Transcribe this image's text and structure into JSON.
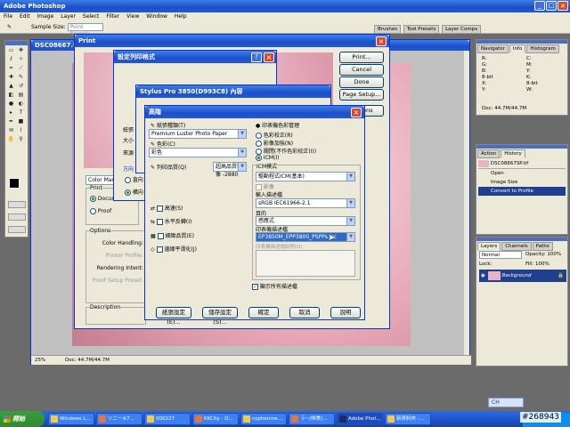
{
  "app": {
    "title": "Adobe Photoshop",
    "menus": [
      "File",
      "Edit",
      "Image",
      "Layer",
      "Select",
      "Filter",
      "View",
      "Window",
      "Help"
    ],
    "options": {
      "sample_size_label": "Sample Size:",
      "sample_size_value": "Point Sample"
    }
  },
  "panel_tabs_top": [
    "Brushes",
    "Tool Presets",
    "Layer Comps"
  ],
  "document": {
    "title": "DSC08667.ti",
    "zoom": "25%",
    "doc_size": "Doc: 44.7M/44.7M"
  },
  "print_dialog": {
    "title": "Print",
    "buttons": [
      "Print...",
      "Cancel",
      "Done",
      "Page Setup...",
      "Options"
    ],
    "color_management_label": "Color Man",
    "print_group": "Print",
    "print_opts": [
      "Docume",
      "Proof"
    ],
    "options_label": "Options",
    "color_handling_label": "Color Handling:",
    "printer_profile_label": "Printer Profile:",
    "rendering_intent_label": "Rendering Intent:",
    "proof_setup_label": "Proof Setup Preset:",
    "description_label": "Description"
  },
  "print_setup_dialog": {
    "title": "設定列印格式",
    "labels": [
      "紙張",
      "大小",
      "來源",
      "方向"
    ],
    "radios": [
      "直向",
      "橫向"
    ]
  },
  "printer_props_dialog": {
    "title": "Stylus Pro 3850(D993C8) 內容"
  },
  "advanced_dialog": {
    "title": "高階",
    "paper_type_label": "紙張種類(T)",
    "paper_type_value": "Premium Luster Photo Paper",
    "color_label": "色彩(C)",
    "color_value": "彩色",
    "quality_label": "列印品質(Q)",
    "quality_value": "超高品質影像 -2880",
    "checks": [
      "高速(S)",
      "水平反轉(I)",
      "細緻品質(E)",
      "邊緣平滑化(J)"
    ],
    "cm_title": "印表機色彩管理",
    "cm_radios": [
      "色彩校正(R)",
      "影像加強(N)",
      "關閉(不作色彩校正)(I)",
      "ICM(I)"
    ],
    "icm_mode_label": "ICM模式",
    "icm_mode_value": "驅動程式ICM(基本)",
    "image_label": "影像",
    "input_profile_label": "輸入描述檔",
    "input_profile_value": "sRGB IEC61966-2.1",
    "intent_label": "目的",
    "intent_value": "感應式",
    "printer_profile_label": "印表機描述檔",
    "printer_profile_value": "EP3850M_EPP3800_PSPPs.icc",
    "printer_profile_desc_label": "印表機描述檔說明(D)",
    "show_all_label": "顯示所有描述檔",
    "buttons": [
      "紙張設定(E)...",
      "儲存設定(S)...",
      "確定",
      "取消",
      "說明"
    ]
  },
  "info_panel": {
    "tabs": [
      "Navigator",
      "Info",
      "Histogram"
    ],
    "rows": [
      "R:",
      "G:",
      "B:",
      "8-bit",
      "X:",
      "Y:"
    ],
    "right_rows": [
      "C:",
      "M:",
      "Y:",
      "K:",
      "8-bit",
      "W:",
      "H:"
    ],
    "doc": "Doc: 44.7M/44.7M"
  },
  "history_panel": {
    "tabs": [
      "Action",
      "History"
    ],
    "snapshot": "DSC08667SP.tif",
    "items": [
      "Open",
      "Image Size",
      "Convert to Profile"
    ]
  },
  "layers_panel": {
    "tabs": [
      "Layers",
      "Channels",
      "Paths"
    ],
    "blend": "Normal",
    "opacity_label": "Opacity:",
    "opacity": "100%",
    "lock_label": "Lock:",
    "fill_label": "Fill:",
    "fill": "100%",
    "layer_name": "Background"
  },
  "taskbar": {
    "start": "開始",
    "items": [
      "Windows L...",
      "ソニー※7...",
      "000227",
      "KKCity - O...",
      "cyphercne...",
      "ラ~(唯美)...",
      "Adobe Phot...",
      "新資料夾 -..."
    ],
    "lang": "CH",
    "watermark": "#268943"
  }
}
